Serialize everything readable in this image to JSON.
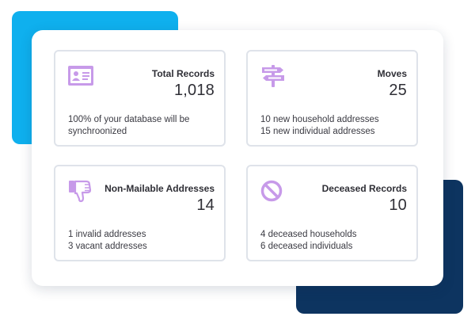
{
  "colors": {
    "accent_cyan": "#0fb0ee",
    "accent_navy": "#0d3460",
    "icon_purple": "#bf8fe4",
    "card_border": "#dfe3ea"
  },
  "cards": [
    {
      "icon": "id-card-icon",
      "title": "Total Records",
      "value": "1,018",
      "lines": [
        "100% of your database will be",
        "synchroonized"
      ]
    },
    {
      "icon": "signpost-icon",
      "title": "Moves",
      "value": "25",
      "lines": [
        "10 new household addresses",
        "15 new individual addresses"
      ]
    },
    {
      "icon": "thumbs-down-icon",
      "title": "Non-Mailable Addresses",
      "value": "14",
      "lines": [
        "1 invalid addresses",
        "3 vacant addresses"
      ]
    },
    {
      "icon": "prohibited-icon",
      "title": "Deceased Records",
      "value": "10",
      "lines": [
        "4 deceased households",
        "6 deceased individuals"
      ]
    }
  ]
}
